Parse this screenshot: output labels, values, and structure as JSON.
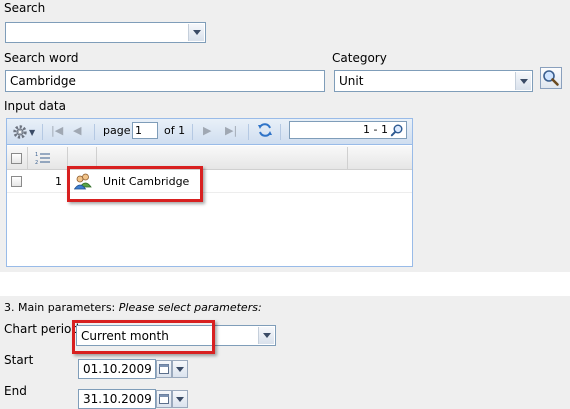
{
  "search": {
    "label": "Search",
    "value": ""
  },
  "search_word": {
    "label": "Search word",
    "value": "Cambridge"
  },
  "category": {
    "label": "Category",
    "value": "Unit"
  },
  "input_data": {
    "label": "Input data",
    "pager": {
      "page_label": "page",
      "page_value": "1",
      "of_label": "of 1",
      "count": "1 - 1"
    },
    "rows": [
      {
        "index": "1",
        "name": "Unit Cambridge"
      }
    ]
  },
  "main_parameters": {
    "label": "3. Main parameters:",
    "hint": "Please select parameters:",
    "chart_period": {
      "label": "Chart period",
      "value": "Current month"
    },
    "start": {
      "label": "Start",
      "value": "01.10.2009"
    },
    "end": {
      "label": "End",
      "value": "31.10.2009"
    }
  },
  "colors": {
    "highlight": "#d82020",
    "panel": "#efefef",
    "grid_border": "#99bbe8"
  },
  "icons": [
    "magnifier-icon",
    "gear-icon",
    "first-page-icon",
    "prev-page-icon",
    "next-page-icon",
    "last-page-icon",
    "refresh-icon",
    "search-icon",
    "numbered-list-icon",
    "users-icon",
    "calendar-icon"
  ]
}
